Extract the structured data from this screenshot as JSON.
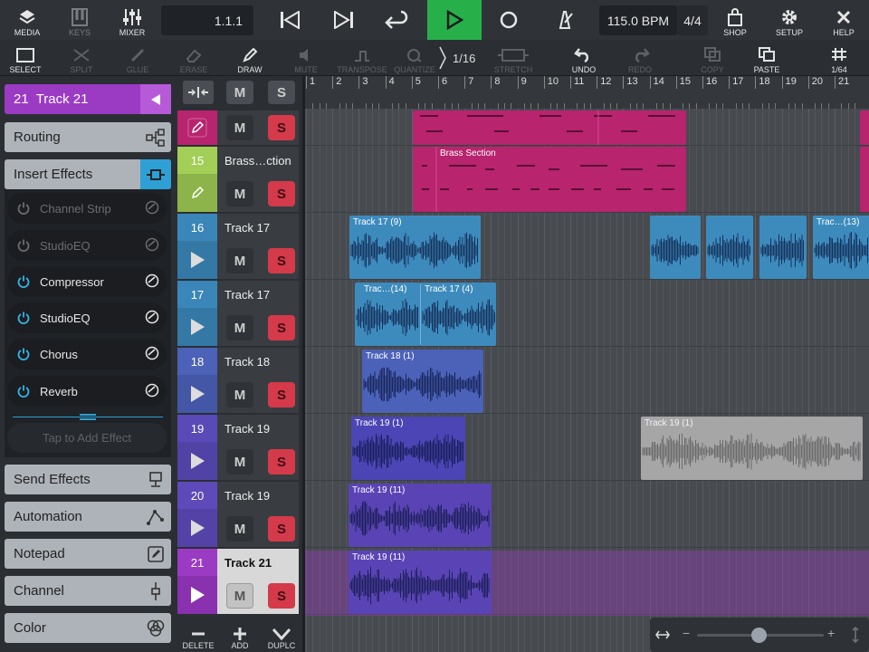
{
  "toolbar": {
    "media": "MEDIA",
    "keys": "KEYS",
    "mixer": "MIXER",
    "position": "1.1.1",
    "tempo": "115.0 BPM",
    "signature": "4/4",
    "shop": "SHOP",
    "setup": "SETUP",
    "help": "HELP"
  },
  "tools": {
    "select": "SELECT",
    "split": "SPLIT",
    "glue": "GLUE",
    "erase": "ERASE",
    "draw": "DRAW",
    "mute": "MUTE",
    "transpose": "TRANSPOSE",
    "quantize": "QUANTIZE",
    "quantize_value": "1/16",
    "stretch": "STRETCH",
    "undo": "UNDO",
    "redo": "REDO",
    "copy": "COPY",
    "paste": "PASTE",
    "grid": "1/64"
  },
  "inspector": {
    "track_number": "21",
    "track_name": "Track 21",
    "routing": "Routing",
    "insert_effects": "Insert Effects",
    "effects": [
      {
        "name": "Channel Strip"
      },
      {
        "name": "StudioEQ"
      },
      {
        "name": "Compressor"
      },
      {
        "name": "StudioEQ"
      },
      {
        "name": "Chorus"
      },
      {
        "name": "Reverb"
      }
    ],
    "add_effect": "Tap to Add Effect",
    "send_effects": "Send Effects",
    "automation": "Automation",
    "notepad": "Notepad",
    "channel": "Channel",
    "color": "Color"
  },
  "header": {
    "m": "M",
    "s": "S"
  },
  "tracks": [
    {
      "num": "",
      "name": ""
    },
    {
      "num": "15",
      "name": "Brass…ction"
    },
    {
      "num": "16",
      "name": "Track 17"
    },
    {
      "num": "17",
      "name": "Track 17"
    },
    {
      "num": "18",
      "name": "Track 18"
    },
    {
      "num": "19",
      "name": "Track 19"
    },
    {
      "num": "20",
      "name": "Track 19"
    },
    {
      "num": "21",
      "name": "Track 21"
    }
  ],
  "ruler": [
    "1",
    "2",
    "3",
    "4",
    "5",
    "6",
    "7",
    "8",
    "9",
    "10",
    "11",
    "12",
    "13",
    "14",
    "15",
    "16",
    "17",
    "18",
    "19",
    "20",
    "21"
  ],
  "clips": {
    "brass": "Brass Section",
    "t17a": "Track 17 (9)",
    "t17b": "Trac…(13)",
    "t17c": "Trac…(14)",
    "t17d": "Track 17 (4)",
    "t18": "Track 18 (1)",
    "t19a": "Track 19 (1)",
    "t19b": "Track 19 (1)",
    "t19c": "Track 19 (11)",
    "t21": "Track 19 (11)"
  },
  "bottom": {
    "delete": "DELETE",
    "add": "ADD",
    "duplicate": "DUPLC"
  },
  "colors": {
    "accent_green": "#27b04a",
    "purple": "#9b3bc4",
    "cyan": "#2ea0d6",
    "solo_red": "#d43a4a",
    "midi_magenta": "#b8246e",
    "audio_blue": "#3d8bbd",
    "audio_indigo": "#4b54b0",
    "audio_violet": "#5a44b5"
  }
}
